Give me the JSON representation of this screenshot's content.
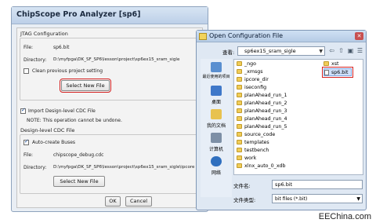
{
  "chipscope": {
    "title": "ChipScope Pro Analyzer [sp6]",
    "jtag_group": "JTAG Configuration",
    "file_label": "File:",
    "file_value": "sp6.bit",
    "directory_label": "Directory:",
    "directory_value": "D:\\myfpga\\DK_SF_SP6\\lesson\\project\\sp6ex15_sram_sigle",
    "clean_label": "Clean previous project setting",
    "select_new_file_1": "Select New File",
    "import_cdc_label": "Import Design-level CDC File",
    "note": "NOTE: This operation cannot be undone.",
    "cdc_group": "Design-level CDC File",
    "auto_create_label": "Auto-create Buses",
    "cdc_file_label": "File:",
    "cdc_file_value": "chipscope_debug.cdc",
    "cdc_dir_label": "Directory:",
    "cdc_dir_value": "D:\\myfpga\\DK_SF_SP6\\lesson\\project\\sp6ex15_sram_sigle\\ipcore",
    "select_new_file_2": "Select New File",
    "ok": "OK",
    "cancel": "Cancel"
  },
  "open_dialog": {
    "title": "Open Configuration File",
    "close_glyph": "✕",
    "look_in_label": "查看:",
    "look_in_value": "sp6ex15_sram_sigle",
    "places": [
      {
        "label": "最近使用的项目",
        "icon": "recent-places-icon"
      },
      {
        "label": "桌面",
        "icon": "desktop-icon"
      },
      {
        "label": "我的文档",
        "icon": "documents-icon"
      },
      {
        "label": "计算机",
        "icon": "computer-icon"
      },
      {
        "label": "网络",
        "icon": "network-icon"
      }
    ],
    "folders_col1": [
      "_ngo",
      "_xmsgs",
      "ipcore_dir",
      "iseconfig",
      "planAhead_run_1",
      "planAhead_run_2",
      "planAhead_run_3",
      "planAhead_run_4",
      "planAhead_run_5",
      "source_code",
      "templates",
      "testbench",
      "work",
      "xlnx_auto_0_xdb"
    ],
    "col2_items": [
      {
        "name": "xst",
        "type": "folder"
      },
      {
        "name": "sp6.bit",
        "type": "file"
      }
    ],
    "file_name_label": "文件名:",
    "file_name_value": "sp6.bit",
    "file_type_label": "文件类型:",
    "file_type_value": "bit files (*.bit)"
  },
  "watermark": "EEChina.com",
  "colors": {
    "highlight": "#d42020",
    "selection": "#cfe1fb",
    "folder": "#f1cd58"
  }
}
